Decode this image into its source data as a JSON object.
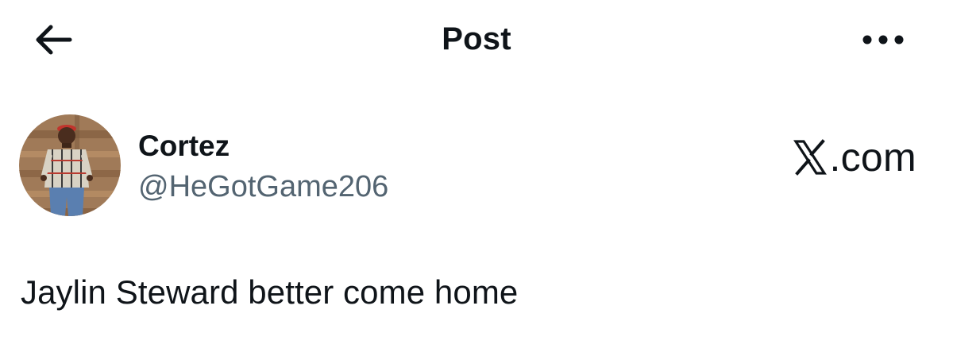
{
  "header": {
    "title": "Post",
    "back_icon": "arrow-left-icon",
    "more_icon": "more-horizontal-icon"
  },
  "author": {
    "display_name": "Cortez",
    "handle": "@HeGotGame206",
    "avatar_icon": "user-avatar"
  },
  "brand": {
    "text": ".com",
    "logo_icon": "x-logo-icon"
  },
  "post": {
    "text": "Jaylin Steward better come home"
  },
  "colors": {
    "text_primary": "#0f1419",
    "text_secondary": "#536471",
    "background": "#ffffff"
  }
}
